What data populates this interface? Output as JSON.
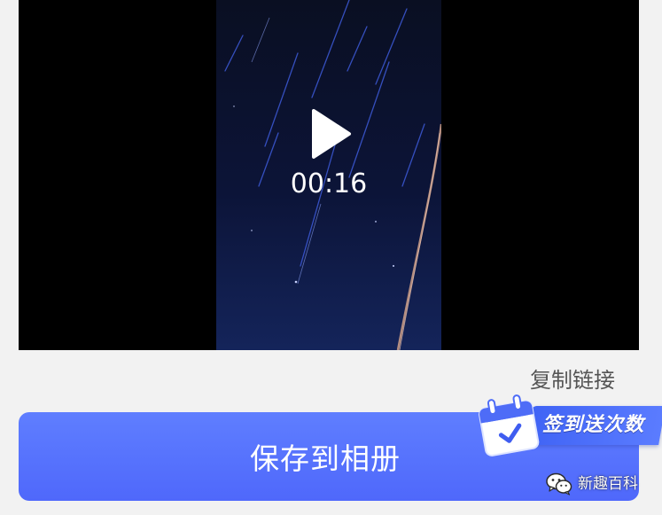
{
  "video": {
    "duration": "00:16",
    "play_icon": "play-icon"
  },
  "actions": {
    "copy_link_label": "复制链接",
    "save_button_label": "保存到相册"
  },
  "promo": {
    "checkin_label": "签到送次数",
    "icon": "calendar-check-icon"
  },
  "watermark": {
    "label": "新趣百科",
    "icon": "wechat-icon"
  },
  "colors": {
    "background": "#f2f2f2",
    "button_primary": "#5570fd",
    "video_background": "#000000",
    "text_secondary": "#555555"
  }
}
